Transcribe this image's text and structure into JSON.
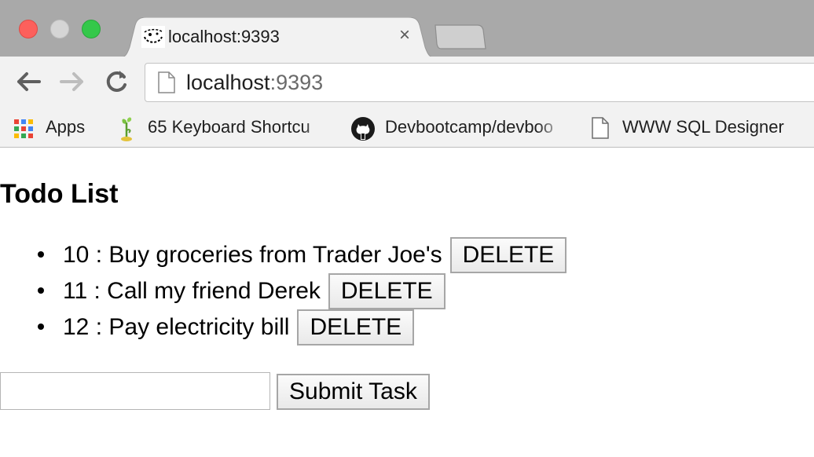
{
  "browser": {
    "tab_title": "localhost:9393",
    "tab_close": "×",
    "url_host": "localhost",
    "url_port": ":9393",
    "bookmarks": [
      {
        "label": "Apps",
        "icon": "apps-grid-icon"
      },
      {
        "label": "65 Keyboard Shortcu",
        "icon": "plant-icon"
      },
      {
        "label": "Devbootcamp/devboo",
        "icon": "github-icon"
      },
      {
        "label": "WWW SQL Designer",
        "icon": "document-icon"
      }
    ]
  },
  "page": {
    "title": "Todo List",
    "todos": [
      {
        "text": "10 : Buy groceries from Trader Joe's",
        "button": "DELETE"
      },
      {
        "text": "11 : Call my friend Derek",
        "button": "DELETE"
      },
      {
        "text": "12 : Pay electricity bill",
        "button": "DELETE"
      }
    ],
    "input_value": "",
    "submit_label": "Submit Task"
  },
  "colors": {
    "close": "#fc605c",
    "minimize": "#d5d5d5",
    "zoom": "#34c84a",
    "chrome": "#a9a9a9",
    "toolbar": "#f2f2f2"
  }
}
